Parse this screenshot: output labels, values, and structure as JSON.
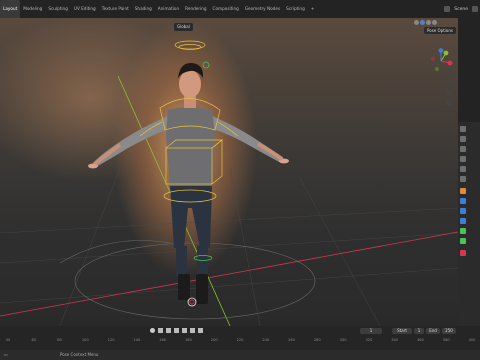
{
  "workspace_tabs": [
    "Layout",
    "Modeling",
    "Sculpting",
    "UV Editing",
    "Texture Paint",
    "Shading",
    "Animation",
    "Rendering",
    "Compositing",
    "Geometry Nodes",
    "Scripting",
    "+"
  ],
  "active_tab": "Layout",
  "scene_name": "Scene",
  "viewport": {
    "mode": "Global",
    "pose_options": "Pose Options"
  },
  "timeline": {
    "frame_current": "1",
    "start_label": "Start",
    "start_value": "1",
    "end_label": "End",
    "end_value": "250",
    "ruler_ticks": [
      "40",
      "60",
      "80",
      "100",
      "120",
      "140",
      "160",
      "180",
      "200",
      "220",
      "240",
      "260",
      "280",
      "300",
      "320",
      "340",
      "360",
      "380",
      "400"
    ]
  },
  "statusbar": {
    "hint": "Pose Context Menu"
  },
  "colors": {
    "accent": "#5680c2",
    "bone_outline": "#e8c23a",
    "axis_x": "#d9354f",
    "axis_y": "#8cbf2f",
    "axis_z": "#3b7fd6"
  }
}
